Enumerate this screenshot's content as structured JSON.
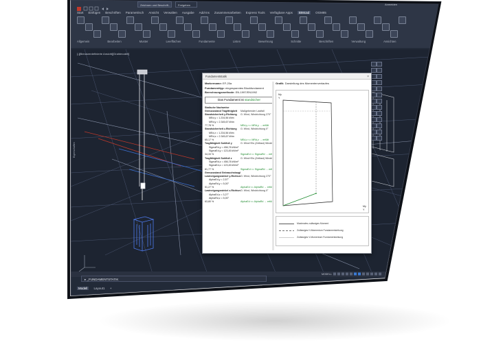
{
  "window": {
    "active_tab": "Zeichnen und Beschrift...",
    "second_tab": "Freigeben",
    "user": "Anmelden"
  },
  "ribbon": {
    "tabs": [
      "Start",
      "Einfügen",
      "Beschriften",
      "Parametrisch",
      "Ansicht",
      "Verwalten",
      "Ausgabe",
      "Add-ins",
      "Zusammenarbeiten",
      "Express Tools",
      "Verfügbare Apps",
      "BIMcad",
      "OGM85"
    ],
    "active_tab_index": 11,
    "panels": [
      "Allgemein",
      "Bearbeiten",
      "Muster",
      "Leerflächen",
      "Fundamente",
      "Listen",
      "Bewehrung",
      "Schnitte",
      "Beschriften",
      "Verwaltung",
      "Ansichten"
    ]
  },
  "drawing": {
    "file_tab": "[-][Benutzerdefinierte Ansicht][Drahtmodell]",
    "layout_tabs": [
      "Modell",
      "Layout1",
      "+"
    ],
    "active_layout": "Modell",
    "command": "_FUNDAMENTSTATIK",
    "model_label": "MODELL",
    "side_label": "Eigenschaften"
  },
  "dialog": {
    "title": "Fundamentstatik",
    "close": "×",
    "fields": [
      {
        "label": "Markername:",
        "value": "EF-20a"
      },
      {
        "label": "Fundamenttyp:",
        "value": "eingespanntes Blockfundament"
      },
      {
        "label": "Berechnungsmethode:",
        "value": "EN-1997/EN1992"
      }
    ],
    "result_prefix": "Das Fundament ist",
    "result_value": "standsicher",
    "section_title": "Statische Nachweise",
    "nachweise": [
      {
        "c1": "Grenzzustand Tragfähigkeit",
        "c2": "Maßgebender Lastfall",
        "bold": true
      },
      {
        "c1": "Standsicherheit y-Richtung",
        "c2": "G: Wind, Windrichtung 270°",
        "bold": true
      },
      {
        "c1": "MEd,y = 1.234,56 kNm",
        "c2": "",
        "indent": true
      },
      {
        "c1": "MRd,y = 2.345,67 kNm",
        "c2": "",
        "indent": true
      },
      {
        "c1": "77,78 %",
        "c2": "MEd,y <= MRd,y  → erfüllt",
        "ok": true
      },
      {
        "c1": "Standsicherheit z-Richtung",
        "c2": "G: Wind, Windrichtung 0°",
        "bold": true
      },
      {
        "c1": "MEd,z = 1.234,56 kNm",
        "c2": "",
        "indent": true
      },
      {
        "c1": "MRd,z = 2.345,67 kNm",
        "c2": "",
        "indent": true
      },
      {
        "c1": "65,17 %",
        "c2": "MEd,z <= MRd,z  → erfüllt",
        "ok": true
      },
      {
        "c1": "Tragfähigkeit Sohlfuß y",
        "c2": "G: Wind+Eis (Zeitlast) Windrichtung 0°",
        "bold": true
      },
      {
        "c1": "SigmaRd,y = 456,78 kN/m²",
        "c2": "",
        "indent": true
      },
      {
        "c1": "SigmaEd,y = 123,45 kN/m²",
        "c2": "",
        "indent": true
      },
      {
        "c1": "34,33 %",
        "c2": "SigmaEd <= SigmaRd  → erfüllt",
        "ok": true
      },
      {
        "c1": "Tragfähigkeit Sohlfuß z",
        "c2": "G: Wind+Eis (Zeitlast) Windrichtung 0°",
        "bold": true
      },
      {
        "c1": "SigmaRd,z = 456,78 kN/m²",
        "c2": "",
        "indent": true
      },
      {
        "c1": "SigmaEd,z = 123,45 kN/m²",
        "c2": "",
        "indent": true
      },
      {
        "c1": "81,77 %",
        "c2": "SigmaEd <= SigmaRd  → erfüllt",
        "ok": true
      },
      {
        "c1": "Grenzzustand Gebrauchstauglichkeit",
        "c2": "",
        "bold": true
      },
      {
        "c1": "Lastneigungswinkel y-Richtung",
        "c2": "G: Wind, Windrichtung 270°",
        "bold": true
      },
      {
        "c1": "AlphaEd,y = 2,57°",
        "c2": "",
        "indent": true
      },
      {
        "c1": "AlphaRd,y = 5,00°",
        "c2": "",
        "indent": true
      },
      {
        "c1": "51,27 %",
        "c2": "AlphaEd <= AlphaRd  → erfüllt",
        "ok": true
      },
      {
        "c1": "Lastneigungswinkel z-Richtung",
        "c2": "G: Wind, Windrichtung 0°",
        "bold": true
      },
      {
        "c1": "AlphaEd,z = 3,27°",
        "c2": "",
        "indent": true
      },
      {
        "c1": "AlphaRd,z = 5,00°",
        "c2": "",
        "indent": true
      },
      {
        "c1": "63,80 %",
        "c2": "AlphaEd <= AlphaRd  → erfüllt",
        "ok": true
      }
    ],
    "grafik_label": "Grafik",
    "grafik_desc": "Darstellung des Momentenverlaufes",
    "axis_top": "My",
    "axis_top2": "Y",
    "axis_bottom": "My",
    "axis_bottom2": "Y",
    "legend": [
      {
        "label": "Maximales zulässiges Moment",
        "style": "solid"
      },
      {
        "label": "Zulässiges H-Momentum Fundamentwirkung",
        "style": "dashed"
      },
      {
        "label": "Zulässiges V-Momentum Fundamentwirkung",
        "style": "thin"
      }
    ]
  }
}
